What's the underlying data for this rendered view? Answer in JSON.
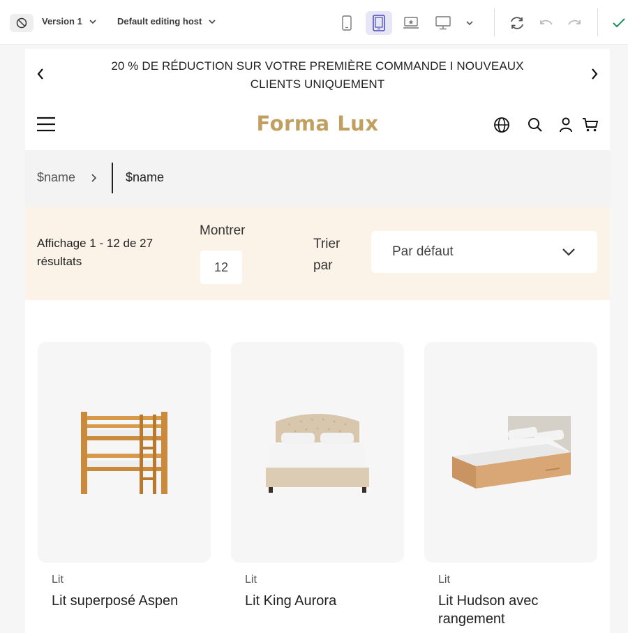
{
  "toolbar": {
    "version_label": "Version 1",
    "host_label": "Default editing host",
    "devices": [
      "phone",
      "tablet",
      "laptop",
      "desktop"
    ],
    "active_device": "tablet",
    "accent_color": "#5b5bd6",
    "confirm_color": "#1a8f5a"
  },
  "announcement": {
    "text": "20 % DE RÉDUCTION SUR VOTRE PREMIÈRE COMMANDE I NOUVEAUX CLIENTS UNIQUEMENT"
  },
  "header": {
    "logo": "Forma Lux",
    "logo_color": "#c0a060",
    "icons": [
      "globe-icon",
      "search-icon",
      "user-icon",
      "cart-icon"
    ]
  },
  "breadcrumb": {
    "items": [
      "$name",
      "$name"
    ]
  },
  "filters": {
    "results_text": "Affichage 1 - 12 de 27 résultats",
    "show_label": "Montrer",
    "show_value": "12",
    "sort_label": "Trier par",
    "sort_value": "Par défaut",
    "background_color": "#fbf3e8"
  },
  "products": [
    {
      "category": "Lit",
      "title": "Lit superposé Aspen",
      "image": "bunk-bed"
    },
    {
      "category": "Lit",
      "title": "Lit King Aurora",
      "image": "upholstered-bed"
    },
    {
      "category": "Lit",
      "title": "Lit Hudson avec rangement",
      "image": "storage-bed"
    }
  ]
}
